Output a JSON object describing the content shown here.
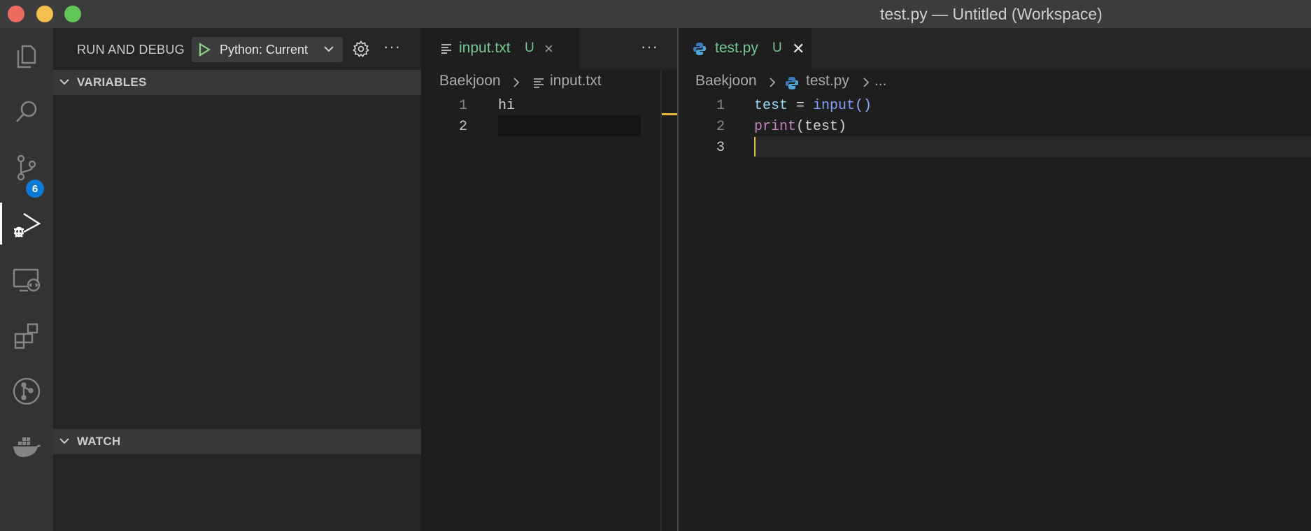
{
  "window": {
    "title": "test.py — Untitled (Workspace)"
  },
  "activity_bar": {
    "items": [
      {
        "name": "explorer-icon"
      },
      {
        "name": "search-icon"
      },
      {
        "name": "source-control-icon",
        "badge": "6"
      },
      {
        "name": "run-and-debug-icon",
        "active": true
      },
      {
        "name": "remote-explorer-icon"
      },
      {
        "name": "extensions-icon"
      },
      {
        "name": "git-graph-icon"
      },
      {
        "name": "docker-icon"
      }
    ]
  },
  "sidebar": {
    "title": "RUN AND DEBUG",
    "config_label": "Python: Current",
    "more": "···",
    "sections": {
      "variables": "VARIABLES",
      "watch": "WATCH"
    }
  },
  "editor_left": {
    "tab": {
      "label": "input.txt",
      "status": "U",
      "close": "×"
    },
    "more": "···",
    "breadcrumb": {
      "folder": "Baekjoon",
      "file": "input.txt"
    },
    "lines": [
      {
        "number": "1",
        "text": "hi"
      },
      {
        "number": "2",
        "text": ""
      }
    ]
  },
  "editor_right": {
    "tab": {
      "label": "test.py",
      "status": "U",
      "close": "✕"
    },
    "breadcrumb": {
      "folder": "Baekjoon",
      "file": "test.py",
      "ellipsis": "..."
    },
    "lines": [
      {
        "number": "1",
        "tokens": {
          "a": "test",
          "b": " = ",
          "c": "input",
          "d": "()"
        }
      },
      {
        "number": "2",
        "tokens": {
          "a": "print",
          "b": "(test)"
        }
      },
      {
        "number": "3",
        "text": ""
      }
    ]
  },
  "colors": {
    "modified": "#73c991",
    "badge": "#0a7ad6",
    "cursor": "#e2b93d",
    "run": "#89d185"
  }
}
